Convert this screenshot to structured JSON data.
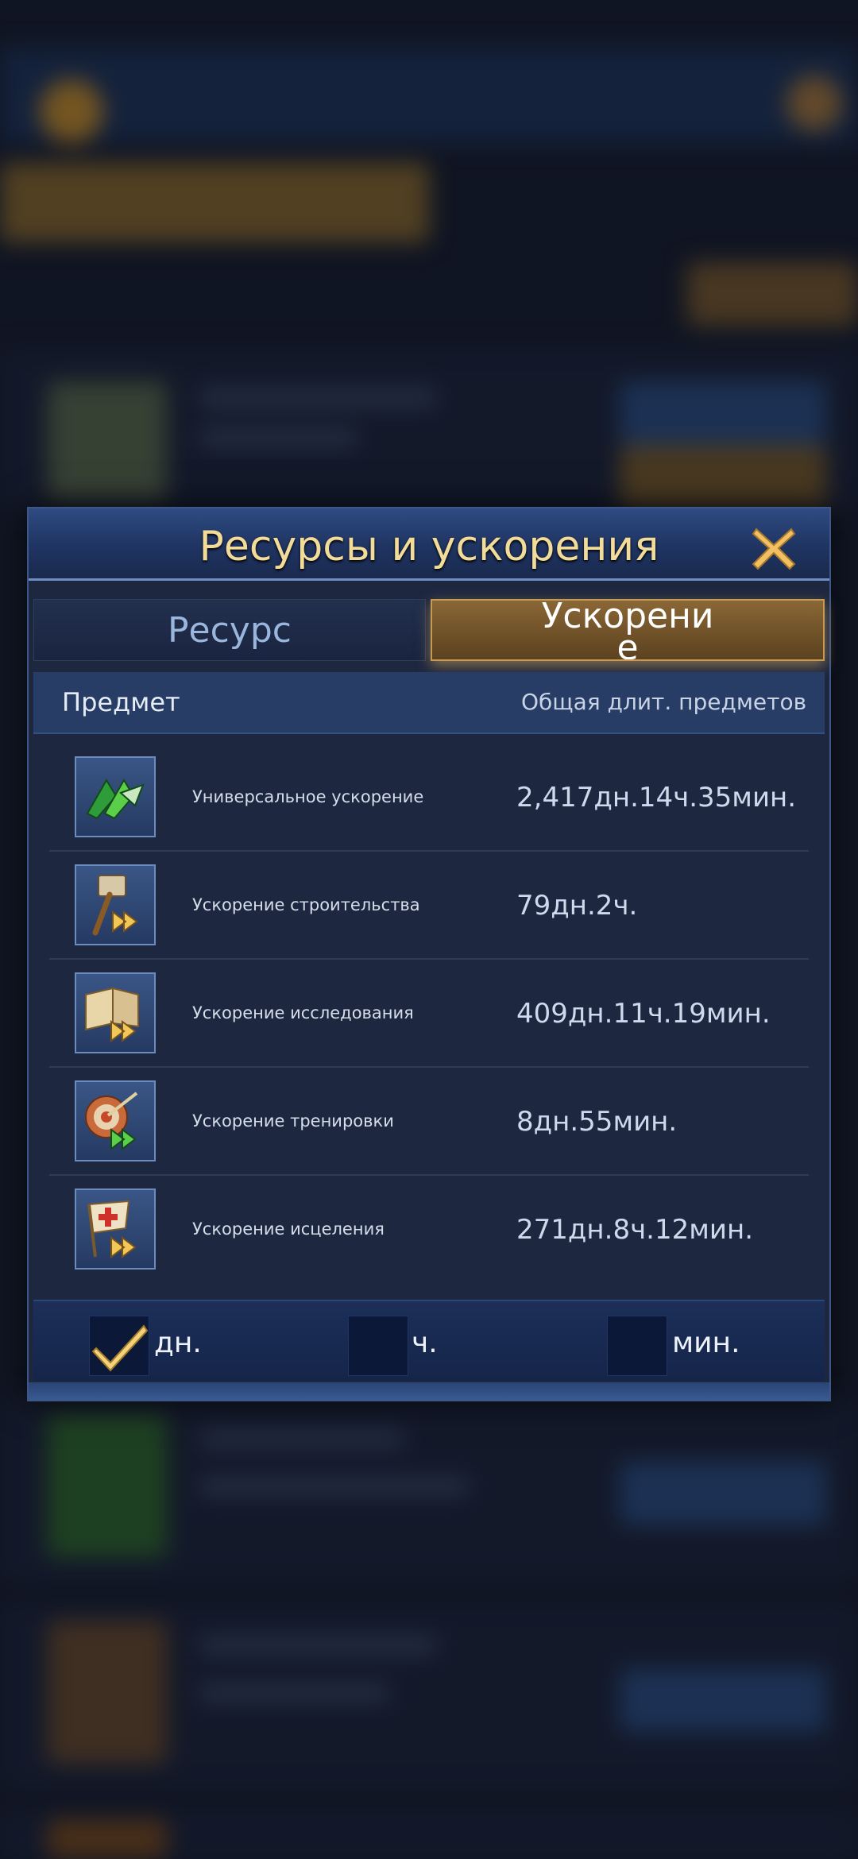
{
  "dialog": {
    "title": "Ресурсы и ускорения",
    "tabs": {
      "resource": "Ресурс",
      "boost": "Ускорение"
    },
    "columns": {
      "item": "Предмет",
      "total": "Общая длит. предметов"
    },
    "items": [
      {
        "name": "Универсальное ускорение",
        "value": "2,417дн.14ч.35мин.",
        "icon": "universal-speedup-icon"
      },
      {
        "name": "Ускорение строительства",
        "value": "79дн.2ч.",
        "icon": "construction-speedup-icon"
      },
      {
        "name": "Ускорение исследования",
        "value": "409дн.11ч.19мин.",
        "icon": "research-speedup-icon"
      },
      {
        "name": "Ускорение тренировки",
        "value": "8дн.55мин.",
        "icon": "training-speedup-icon"
      },
      {
        "name": "Ускорение исцеления",
        "value": "271дн.8ч.12мин.",
        "icon": "healing-speedup-icon"
      }
    ],
    "units": [
      {
        "label": "дн.",
        "checked": true
      },
      {
        "label": "ч.",
        "checked": false
      },
      {
        "label": "мин.",
        "checked": false
      }
    ]
  },
  "colors": {
    "title": "#f3dc9a",
    "active_tab": "#8a6736",
    "panel": "#1d2740"
  }
}
